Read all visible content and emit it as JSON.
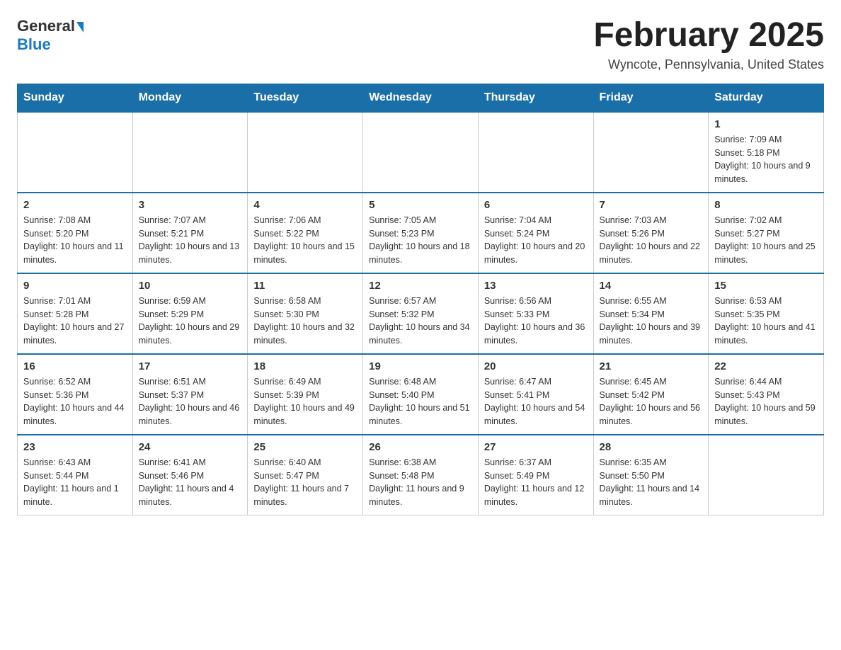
{
  "header": {
    "logo_general": "General",
    "logo_blue": "Blue",
    "month_title": "February 2025",
    "location": "Wyncote, Pennsylvania, United States"
  },
  "weekdays": [
    "Sunday",
    "Monday",
    "Tuesday",
    "Wednesday",
    "Thursday",
    "Friday",
    "Saturday"
  ],
  "weeks": [
    [
      {
        "day": "",
        "info": ""
      },
      {
        "day": "",
        "info": ""
      },
      {
        "day": "",
        "info": ""
      },
      {
        "day": "",
        "info": ""
      },
      {
        "day": "",
        "info": ""
      },
      {
        "day": "",
        "info": ""
      },
      {
        "day": "1",
        "info": "Sunrise: 7:09 AM\nSunset: 5:18 PM\nDaylight: 10 hours and 9 minutes."
      }
    ],
    [
      {
        "day": "2",
        "info": "Sunrise: 7:08 AM\nSunset: 5:20 PM\nDaylight: 10 hours and 11 minutes."
      },
      {
        "day": "3",
        "info": "Sunrise: 7:07 AM\nSunset: 5:21 PM\nDaylight: 10 hours and 13 minutes."
      },
      {
        "day": "4",
        "info": "Sunrise: 7:06 AM\nSunset: 5:22 PM\nDaylight: 10 hours and 15 minutes."
      },
      {
        "day": "5",
        "info": "Sunrise: 7:05 AM\nSunset: 5:23 PM\nDaylight: 10 hours and 18 minutes."
      },
      {
        "day": "6",
        "info": "Sunrise: 7:04 AM\nSunset: 5:24 PM\nDaylight: 10 hours and 20 minutes."
      },
      {
        "day": "7",
        "info": "Sunrise: 7:03 AM\nSunset: 5:26 PM\nDaylight: 10 hours and 22 minutes."
      },
      {
        "day": "8",
        "info": "Sunrise: 7:02 AM\nSunset: 5:27 PM\nDaylight: 10 hours and 25 minutes."
      }
    ],
    [
      {
        "day": "9",
        "info": "Sunrise: 7:01 AM\nSunset: 5:28 PM\nDaylight: 10 hours and 27 minutes."
      },
      {
        "day": "10",
        "info": "Sunrise: 6:59 AM\nSunset: 5:29 PM\nDaylight: 10 hours and 29 minutes."
      },
      {
        "day": "11",
        "info": "Sunrise: 6:58 AM\nSunset: 5:30 PM\nDaylight: 10 hours and 32 minutes."
      },
      {
        "day": "12",
        "info": "Sunrise: 6:57 AM\nSunset: 5:32 PM\nDaylight: 10 hours and 34 minutes."
      },
      {
        "day": "13",
        "info": "Sunrise: 6:56 AM\nSunset: 5:33 PM\nDaylight: 10 hours and 36 minutes."
      },
      {
        "day": "14",
        "info": "Sunrise: 6:55 AM\nSunset: 5:34 PM\nDaylight: 10 hours and 39 minutes."
      },
      {
        "day": "15",
        "info": "Sunrise: 6:53 AM\nSunset: 5:35 PM\nDaylight: 10 hours and 41 minutes."
      }
    ],
    [
      {
        "day": "16",
        "info": "Sunrise: 6:52 AM\nSunset: 5:36 PM\nDaylight: 10 hours and 44 minutes."
      },
      {
        "day": "17",
        "info": "Sunrise: 6:51 AM\nSunset: 5:37 PM\nDaylight: 10 hours and 46 minutes."
      },
      {
        "day": "18",
        "info": "Sunrise: 6:49 AM\nSunset: 5:39 PM\nDaylight: 10 hours and 49 minutes."
      },
      {
        "day": "19",
        "info": "Sunrise: 6:48 AM\nSunset: 5:40 PM\nDaylight: 10 hours and 51 minutes."
      },
      {
        "day": "20",
        "info": "Sunrise: 6:47 AM\nSunset: 5:41 PM\nDaylight: 10 hours and 54 minutes."
      },
      {
        "day": "21",
        "info": "Sunrise: 6:45 AM\nSunset: 5:42 PM\nDaylight: 10 hours and 56 minutes."
      },
      {
        "day": "22",
        "info": "Sunrise: 6:44 AM\nSunset: 5:43 PM\nDaylight: 10 hours and 59 minutes."
      }
    ],
    [
      {
        "day": "23",
        "info": "Sunrise: 6:43 AM\nSunset: 5:44 PM\nDaylight: 11 hours and 1 minute."
      },
      {
        "day": "24",
        "info": "Sunrise: 6:41 AM\nSunset: 5:46 PM\nDaylight: 11 hours and 4 minutes."
      },
      {
        "day": "25",
        "info": "Sunrise: 6:40 AM\nSunset: 5:47 PM\nDaylight: 11 hours and 7 minutes."
      },
      {
        "day": "26",
        "info": "Sunrise: 6:38 AM\nSunset: 5:48 PM\nDaylight: 11 hours and 9 minutes."
      },
      {
        "day": "27",
        "info": "Sunrise: 6:37 AM\nSunset: 5:49 PM\nDaylight: 11 hours and 12 minutes."
      },
      {
        "day": "28",
        "info": "Sunrise: 6:35 AM\nSunset: 5:50 PM\nDaylight: 11 hours and 14 minutes."
      },
      {
        "day": "",
        "info": ""
      }
    ]
  ]
}
